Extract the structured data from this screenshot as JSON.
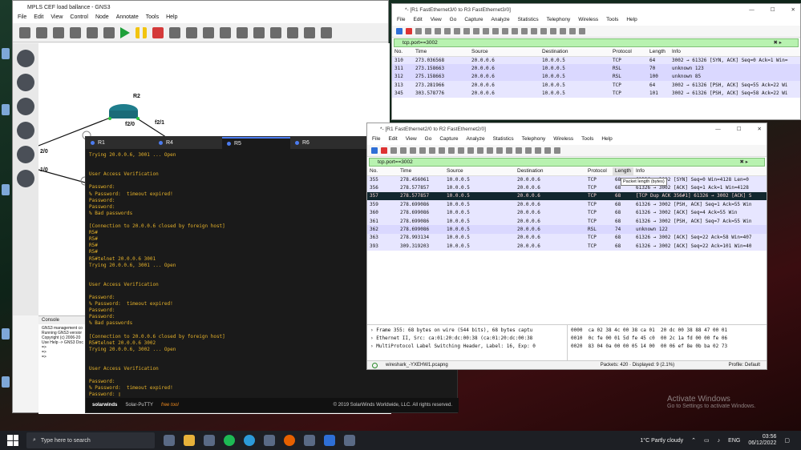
{
  "gns3": {
    "title": "MPLS CEF load ballance - GNS3",
    "menu": [
      "File",
      "Edit",
      "View",
      "Control",
      "Node",
      "Annotate",
      "Tools",
      "Help"
    ],
    "router_label": "R2",
    "if_left": "f2/0",
    "if_right": "f2/1",
    "edge_left_top": "2/0",
    "edge_left_bottom": "1/0",
    "console_title": "Console",
    "console_lines": [
      "GNS3 management co",
      "Running GNS3 versior",
      "Copyright (c) 2006-20",
      "Use Help -> GNS3 Doc",
      "",
      "=>",
      "=>",
      "=>"
    ]
  },
  "putty": {
    "tabs": [
      "R1",
      "R4",
      "R5",
      "R6"
    ],
    "active_tab": "R5",
    "terminal": "Trying 20.0.0.6, 3001 ... Open\n\n\nUser Access Verification\n\nPassword:\n% Password:  timeout expired!\nPassword:\nPassword:\n% Bad passwords\n\n[Connection to 20.0.0.6 closed by foreign host]\nR5#\nR5#\nR5#\nR5#\nR5#telnet 20.0.0.6 3001\nTrying 20.0.0.6, 3001 ... Open\n\n\nUser Access Verification\n\nPassword:\n% Password:  timeout expired!\nPassword:\nPassword:\n% Bad passwords\n\n[Connection to 20.0.0.6 closed by foreign host]\nR5#telnet 20.0.0.6 3002\nTrying 20.0.0.6, 3002 ... Open\n\n\nUser Access Verification\n\nPassword:\n% Password:  timeout expired!\nPassword: ▯",
    "brand": "solarwinds",
    "product": "Solar-PuTTY",
    "free": "free tool",
    "copyright": "© 2019 SolarWinds Worldwide, LLC. All rights reserved."
  },
  "ws2": {
    "title": "*- [R1 FastEthernet3/0 to R3 FastEthernet3/0]",
    "menu": [
      "File",
      "Edit",
      "View",
      "Go",
      "Capture",
      "Analyze",
      "Statistics",
      "Telephony",
      "Wireless",
      "Tools",
      "Help"
    ],
    "filter": "tcp.port==3002",
    "columns": [
      "No.",
      "Time",
      "Source",
      "Destination",
      "Protocol",
      "Length",
      "Info"
    ],
    "rows": [
      [
        "310",
        "273.036568",
        "20.0.0.6",
        "10.0.0.5",
        "TCP",
        "64",
        "3002 → 61326 [SYN, ACK] Seq=0 Ack=1 Win="
      ],
      [
        "311",
        "273.158663",
        "20.0.0.6",
        "10.0.0.5",
        "RSL",
        "70",
        "unknown 123"
      ],
      [
        "312",
        "275.158663",
        "20.0.0.6",
        "10.0.0.5",
        "RSL",
        "100",
        "unknown 85"
      ],
      [
        "313",
        "273.281966",
        "20.0.0.6",
        "10.0.0.5",
        "TCP",
        "64",
        "3002 → 61326 [PSH, ACK] Seq=55 Ack=22 Wi"
      ],
      [
        "345",
        "303.578776",
        "20.0.0.6",
        "10.0.0.5",
        "TCP",
        "101",
        "3002 → 61326 [PSH, ACK] Seq=58 Ack=22 Wi"
      ]
    ]
  },
  "ws1": {
    "title": "*- [R1 FastEthernet2/0 to R2 FastEthernet2/0]",
    "menu": [
      "File",
      "Edit",
      "View",
      "Go",
      "Capture",
      "Analyze",
      "Statistics",
      "Telephony",
      "Wireless",
      "Tools",
      "Help"
    ],
    "filter": "tcp.port==3002",
    "columns": [
      "No.",
      "Time",
      "Source",
      "Destination",
      "Protocol",
      "Length",
      "Info"
    ],
    "rows": [
      [
        "355",
        "278.456061",
        "10.0.0.5",
        "20.0.0.6",
        "TCP",
        "68",
        "61326 → 3002 [SYN] Seq=0 Win=4128 Len=0"
      ],
      [
        "356",
        "278.577857",
        "10.0.0.5",
        "20.0.0.6",
        "TCP",
        "68",
        "61326 → 3002 [ACK] Seq=1 Ack=1 Win=4128"
      ],
      [
        "357",
        "278.577857",
        "10.0.0.5",
        "20.0.0.6",
        "TCP",
        "68",
        "[TCP Dup ACK 356#1] 61326 → 3002 [ACK] S"
      ],
      [
        "359",
        "278.699086",
        "10.0.0.5",
        "20.0.0.6",
        "TCP",
        "68",
        "61326 → 3002 [PSH, ACK] Seq=1 Ack=55 Win"
      ],
      [
        "360",
        "278.699086",
        "10.0.0.5",
        "20.0.0.6",
        "TCP",
        "68",
        "61326 → 3002 [ACK] Seq=4 Ack=55 Win"
      ],
      [
        "361",
        "278.699086",
        "10.0.0.5",
        "20.0.0.6",
        "TCP",
        "68",
        "61326 → 3002 [PSH, ACK] Seq=7 Ack=55 Win"
      ],
      [
        "362",
        "278.699086",
        "10.0.0.5",
        "20.0.0.6",
        "RSL",
        "74",
        "unknown 122"
      ],
      [
        "363",
        "278.993134",
        "10.0.0.5",
        "20.0.0.6",
        "TCP",
        "68",
        "61326 → 3002 [ACK] Seq=22 Ack=58 Win=407"
      ],
      [
        "393",
        "309.319203",
        "10.0.0.5",
        "20.0.0.6",
        "TCP",
        "68",
        "61326 → 3002 [ACK] Seq=22 Ack=101 Win=40"
      ]
    ],
    "tooltip": "Packet length (bytes)",
    "details": [
      "› Frame 355: 68 bytes on wire (544 bits), 68 bytes captu",
      "› Ethernet II, Src: ca:01:20:dc:00:38 (ca:01:20:dc:00:38",
      "› MultiProtocol Label Switching Header, Label: 16, Exp: 0"
    ],
    "hex": "0000  ca 02 38 4c 00 38 ca 01  20 dc 00 38 88 47 00 01\n0010  0c fe 00 01 5d fe 45 c0  00 2c 1a fd 00 00 fe 06\n0020  83 04 0a 00 00 05 14 00  00 06 ef 8e 0b ba 02 73",
    "file": "wireshark_-YXEHW1.pcapng",
    "packets": "Packets: 420 · Displayed: 9 (2.1%)",
    "profile": "Profile: Default"
  },
  "taskbar": {
    "search_placeholder": "Type here to search",
    "weather": "1°C  Partly cloudy",
    "lang": "ENG",
    "time": "03:56",
    "date": "06/12/2022"
  },
  "watermark": {
    "title": "Activate Windows",
    "subtitle": "Go to Settings to activate Windows."
  }
}
